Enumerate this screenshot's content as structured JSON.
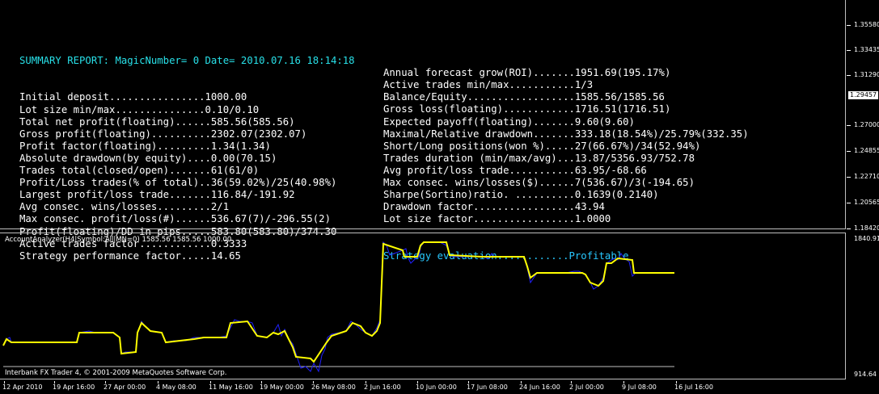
{
  "report": {
    "header": "SUMMARY REPORT: MagicNumber= 0 Date= 2010.07.16 18:14:18",
    "left_rows": [
      "Initial deposit................1000.00",
      "Lot size min/max...............0.10/0.10",
      "Total net profit(floating)......585.56(585.56)",
      "Gross profit(floating)..........2302.07(2302.07)",
      "Profit factor(floating).........1.34(1.34)",
      "Absolute drawdown(by equity)....0.00(70.15)",
      "Trades total(closed/open).......61(61/0)",
      "Profit/Loss trades(% of total)..36(59.02%)/25(40.98%)",
      "Largest profit/loss trade.......116.84/-191.92",
      "Avg consec. wins/losses.........2/1",
      "Max consec. profit/loss(#)......536.67(7)/-296.55(2)",
      "Profit(floating)/DD in pips.....583.80(583.80)/374.30",
      "Active trades factor............0.3333",
      "Strategy performance factor.....14.65"
    ],
    "right_rows": [
      "Annual forecast grow(ROI).......1951.69(195.17%)",
      "Active trades min/max...........1/3",
      "Balance/Equity..................1585.56/1585.56",
      "Gross loss(floating)............1716.51(1716.51)",
      "Expected payoff(floating).......9.60(9.60)",
      "Maximal/Relative drawdown.......333.18(18.54%)/25.79%(332.35)",
      "Short/Long positions(won %).....27(66.67%)/34(52.94%)",
      "Trades duration (min/max/avg)...13.87/5356.93/752.78",
      "Avg profit/loss trade...........63.95/-68.66",
      "Max consec. wins/losses($)......7(536.67)/3(-194.65)",
      "Sharpe(Sortino)ratio. ..........0.1639(0.2140)",
      "Drawdown factor.................43.94",
      "Lot size factor.................1.0000"
    ],
    "evaluation": "Strategy evaluation............Profitable"
  },
  "price_scale": {
    "labels": [
      "1.35580",
      "1.33435",
      "1.31290",
      "1.27000",
      "1.24855",
      "1.22710",
      "1.20565",
      "1.18420"
    ],
    "current": "1.29457"
  },
  "indicator": {
    "title": "AccountAnalyzer(H4|Symbol:All|MN=0) 1585.56 1585.56 1000.00",
    "scale_top": "1840.91",
    "scale_bottom": "914.64",
    "footer": "Interbank FX Trader 4, © 2001-2009 MetaQuotes Software Corp."
  },
  "time_axis": [
    "12 Apr 2010",
    "19 Apr 16:00",
    "27 Apr 00:00",
    "4 May 08:00",
    "11 May 16:00",
    "19 May 00:00",
    "26 May 08:00",
    "2 Jun 16:00",
    "10 Jun 00:00",
    "17 Jun 08:00",
    "24 Jun 16:00",
    "2 Jul 00:00",
    "9 Jul 08:00",
    "16 Jul 16:00"
  ],
  "colors": {
    "balance": "#ffff00",
    "equity": "#2020ff",
    "header": "#28e0e8",
    "evaluation": "#28c8ff"
  }
}
